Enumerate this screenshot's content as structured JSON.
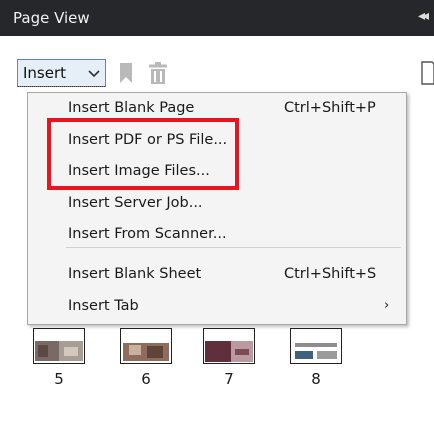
{
  "panel": {
    "title": "Page View",
    "collapse_glyph": "◂◂"
  },
  "toolbar": {
    "insert_label": "Insert",
    "icons": [
      "bookmark-icon",
      "trash-icon",
      "page-icon"
    ]
  },
  "menu": {
    "items": [
      {
        "label": "Insert Blank Page",
        "shortcut": "Ctrl+Shift+P"
      },
      {
        "label": "Insert PDF or PS File..."
      },
      {
        "label": "Insert Image Files..."
      },
      {
        "label": "Insert Server Job..."
      },
      {
        "label": "Insert From Scanner..."
      },
      {
        "label": "Insert Blank Sheet",
        "shortcut": "Ctrl+Shift+S"
      },
      {
        "label": "Insert Tab",
        "submenu_glyph": "›"
      }
    ]
  },
  "thumbnails": [
    {
      "page": "5"
    },
    {
      "page": "6"
    },
    {
      "page": "7"
    },
    {
      "page": "8"
    }
  ],
  "colors": {
    "titlebar": "#25272a",
    "menu_bg": "#f4f4f4",
    "highlight": "#e8141e",
    "button_border": "#5a86b8"
  }
}
